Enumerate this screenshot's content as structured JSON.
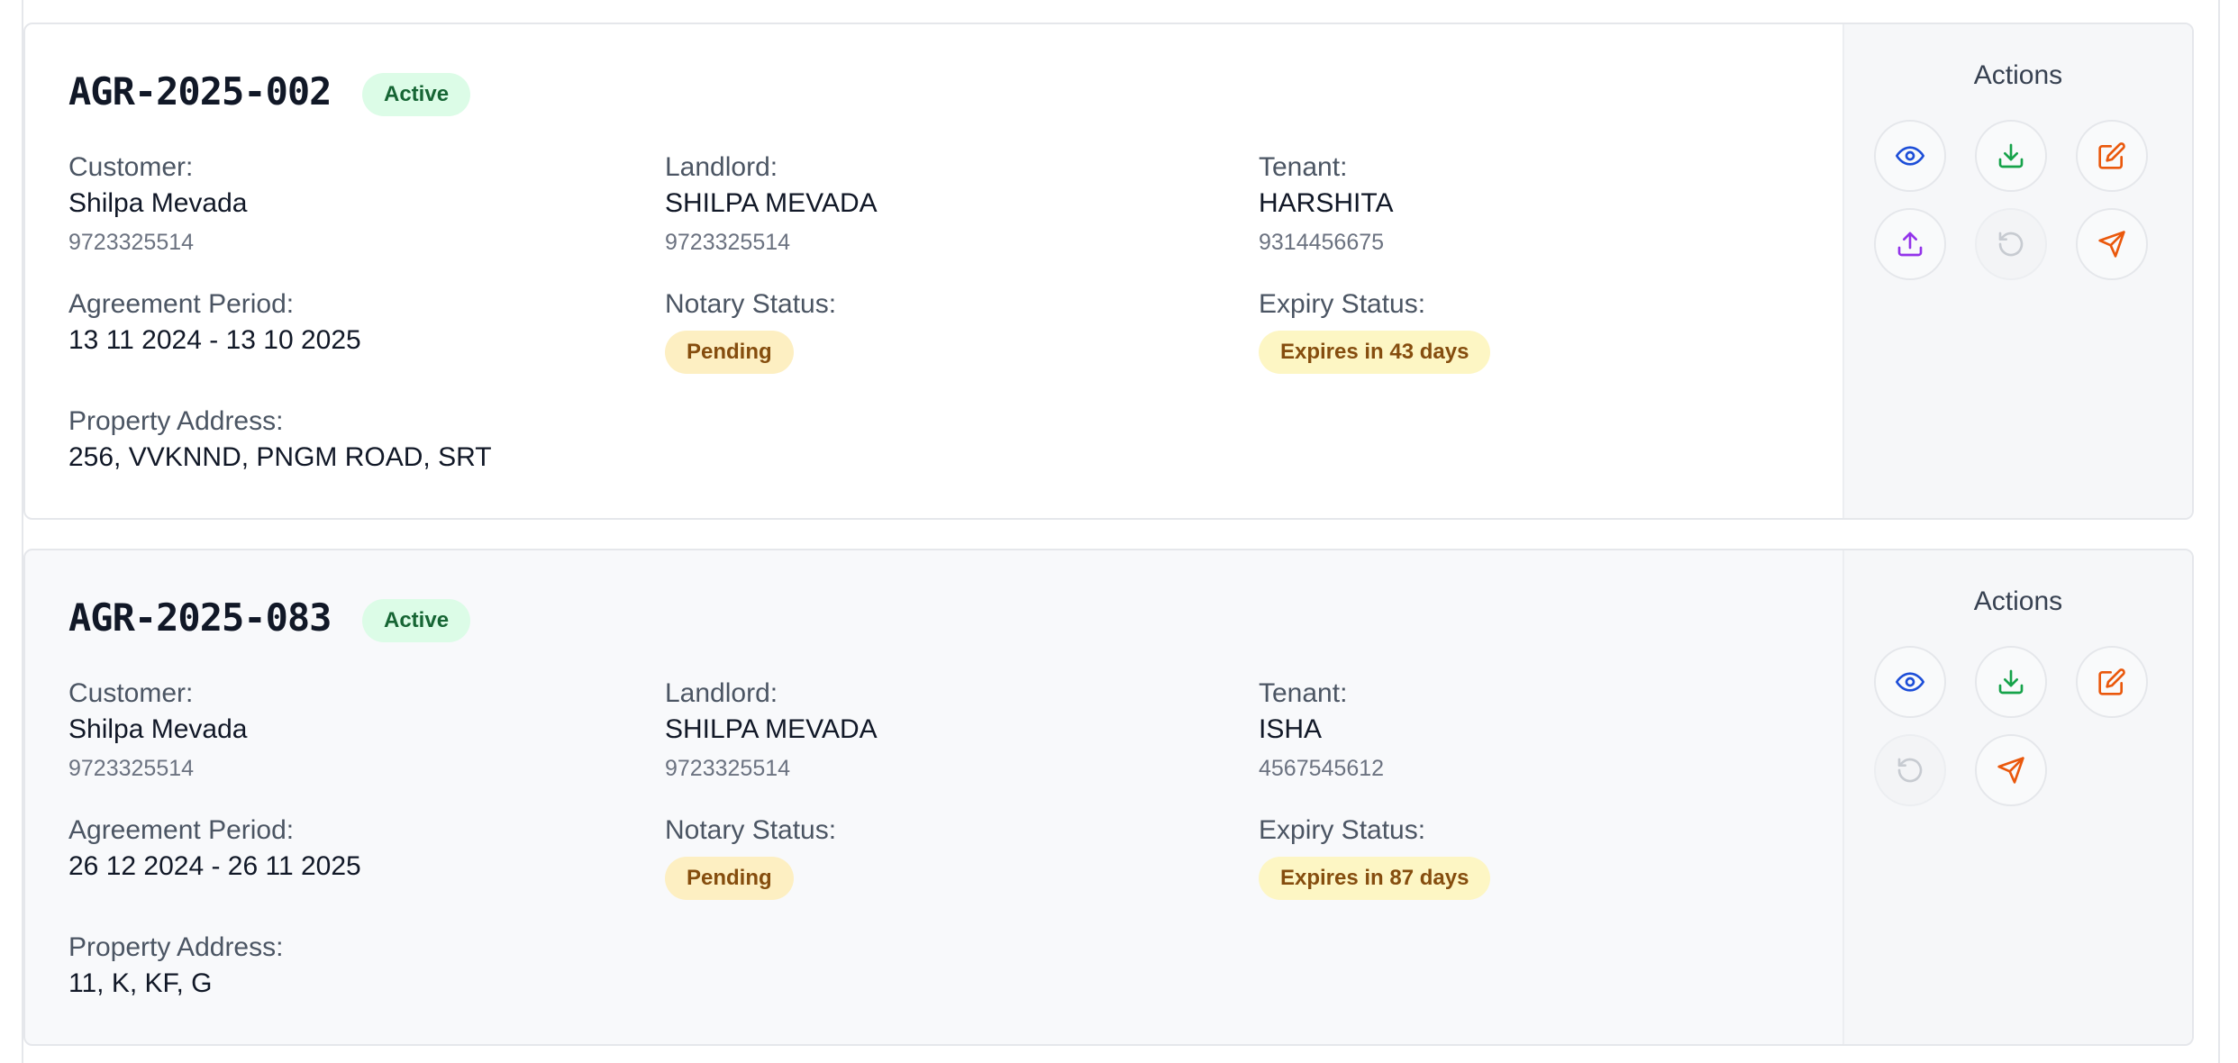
{
  "labels": {
    "customer": "Customer:",
    "landlord": "Landlord:",
    "tenant": "Tenant:",
    "agreement_period": "Agreement Period:",
    "notary_status": "Notary Status:",
    "expiry_status": "Expiry Status:",
    "property_address": "Property Address:",
    "actions": "Actions"
  },
  "colors": {
    "view": "#1d4ed8",
    "download": "#16a34a",
    "edit": "#ea580c",
    "upload": "#9333ea",
    "renew_disabled": "#c7cbd1",
    "send": "#ea580c"
  },
  "agreements": [
    {
      "id": "AGR-2025-002",
      "status": "Active",
      "customer_name": "Shilpa Mevada",
      "customer_phone": "9723325514",
      "landlord_name": "SHILPA MEVADA",
      "landlord_phone": "9723325514",
      "tenant_name": "HARSHITA",
      "tenant_phone": "9314456675",
      "period": "13 11 2024 - 13 10 2025",
      "notary_status": "Pending",
      "expiry_status": "Expires in 43 days",
      "address": "256, VVKNND, PNGM ROAD, SRT",
      "action_icons": [
        "eye-icon",
        "download-icon",
        "edit-icon",
        "upload-icon",
        "renew-icon",
        "send-icon"
      ]
    },
    {
      "id": "AGR-2025-083",
      "status": "Active",
      "customer_name": "Shilpa Mevada",
      "customer_phone": "9723325514",
      "landlord_name": "SHILPA MEVADA",
      "landlord_phone": "9723325514",
      "tenant_name": "ISHA",
      "tenant_phone": "4567545612",
      "period": "26 12 2024 - 26 11 2025",
      "notary_status": "Pending",
      "expiry_status": "Expires in 87 days",
      "address": "11, K, KF, G",
      "action_icons": [
        "eye-icon",
        "download-icon",
        "edit-icon",
        "renew-icon",
        "send-icon"
      ]
    }
  ]
}
